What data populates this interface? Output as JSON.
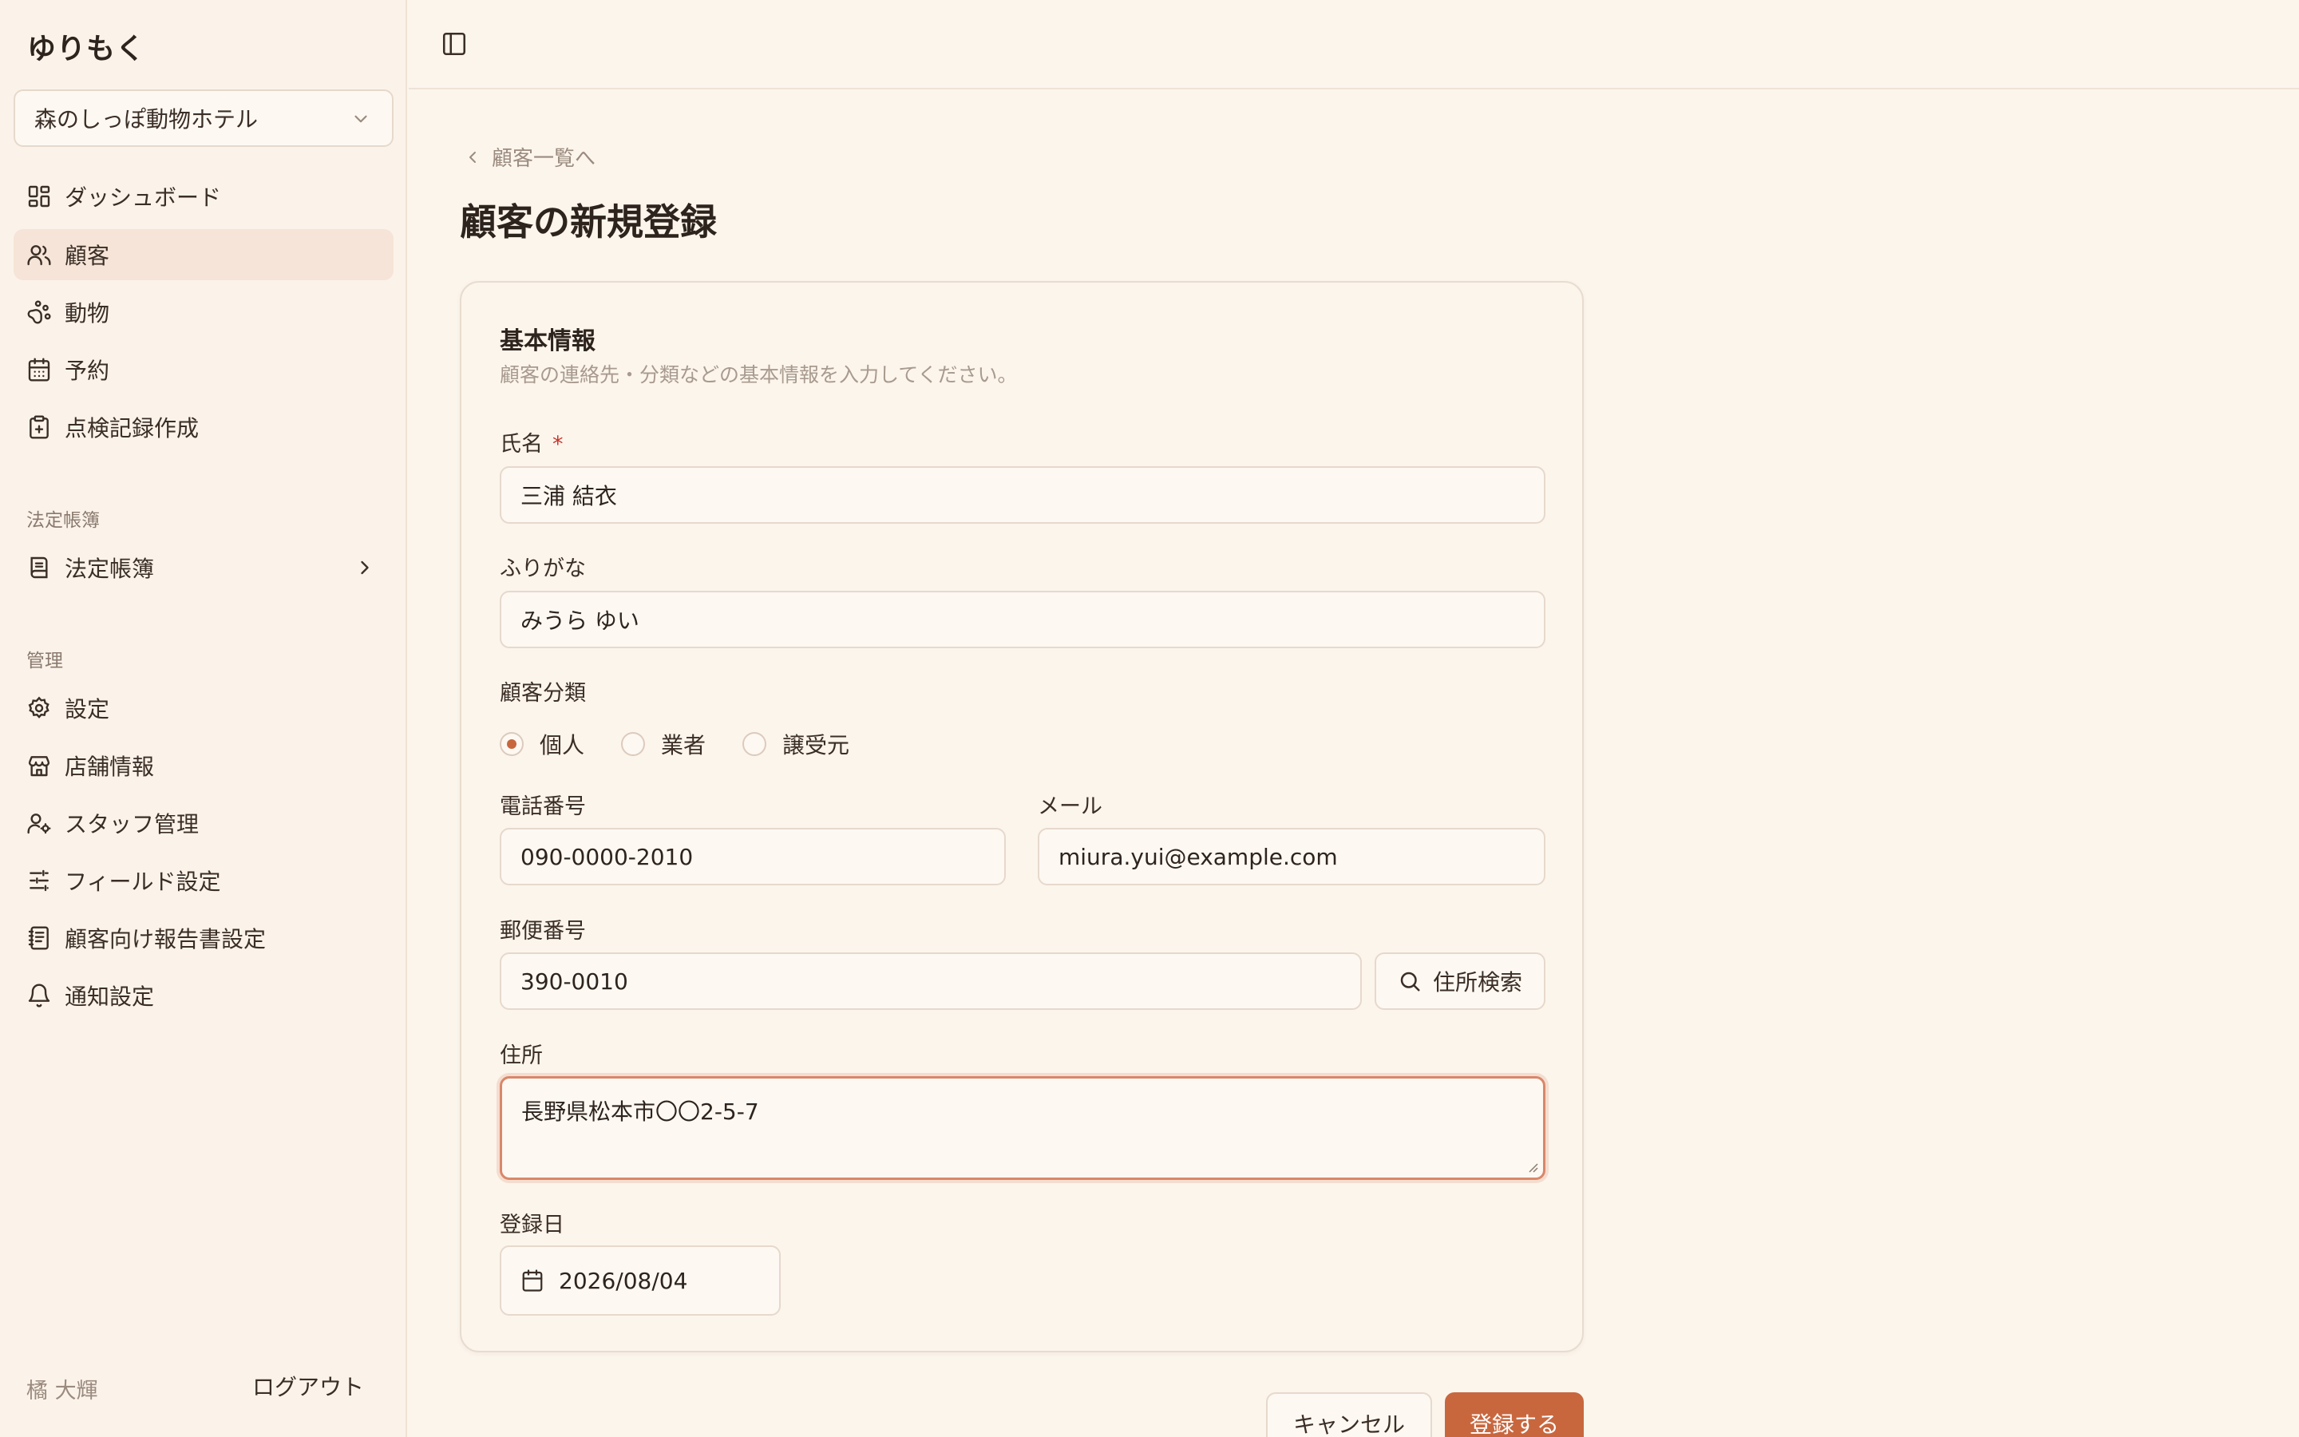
{
  "sidebar": {
    "brand": "ゆりもく",
    "store": "森のしっぽ動物ホテル",
    "items": [
      {
        "label": "ダッシュボード",
        "icon": "dashboard-icon"
      },
      {
        "label": "顧客",
        "icon": "users-icon",
        "active": true
      },
      {
        "label": "動物",
        "icon": "paw-icon"
      },
      {
        "label": "予約",
        "icon": "calendar-icon"
      },
      {
        "label": "点検記録作成",
        "icon": "clipboard-plus-icon"
      }
    ],
    "section_ledger": "法定帳簿",
    "ledger_item": {
      "label": "法定帳簿",
      "icon": "book-icon"
    },
    "section_admin": "管理",
    "admin_items": [
      {
        "label": "設定",
        "icon": "gear-icon"
      },
      {
        "label": "店舗情報",
        "icon": "store-icon"
      },
      {
        "label": "スタッフ管理",
        "icon": "user-settings-icon"
      },
      {
        "label": "フィールド設定",
        "icon": "sliders-icon"
      },
      {
        "label": "顧客向け報告書設定",
        "icon": "report-icon"
      },
      {
        "label": "通知設定",
        "icon": "bell-icon"
      }
    ],
    "user_name": "橘 大輝",
    "logout": "ログアウト"
  },
  "main": {
    "back_link": "顧客一覧へ",
    "title": "顧客の新規登録",
    "card": {
      "title": "基本情報",
      "description": "顧客の連絡先・分類などの基本情報を入力してください。"
    },
    "form": {
      "name_label": "氏名",
      "name_required": "*",
      "name_value": "三浦 結衣",
      "furigana_label": "ふりがな",
      "furigana_value": "みうら ゆい",
      "category_label": "顧客分類",
      "category_options": [
        "個人",
        "業者",
        "譲受元"
      ],
      "category_selected": "個人",
      "phone_label": "電話番号",
      "phone_value": "090-0000-2010",
      "email_label": "メール",
      "email_value": "miura.yui@example.com",
      "postal_label": "郵便番号",
      "postal_value": "390-0010",
      "address_search": "住所検索",
      "address_label": "住所",
      "address_value": "長野県松本市〇〇2-5-7",
      "reg_date_label": "登録日",
      "reg_date_value": "2026/08/04"
    },
    "actions": {
      "cancel": "キャンセル",
      "submit": "登録する"
    }
  },
  "colors": {
    "background": "#fcf5ec",
    "accent": "#c8673e",
    "active_nav": "#f5e4d7",
    "focus_ring": "#d9876b",
    "required": "#c8352b"
  }
}
